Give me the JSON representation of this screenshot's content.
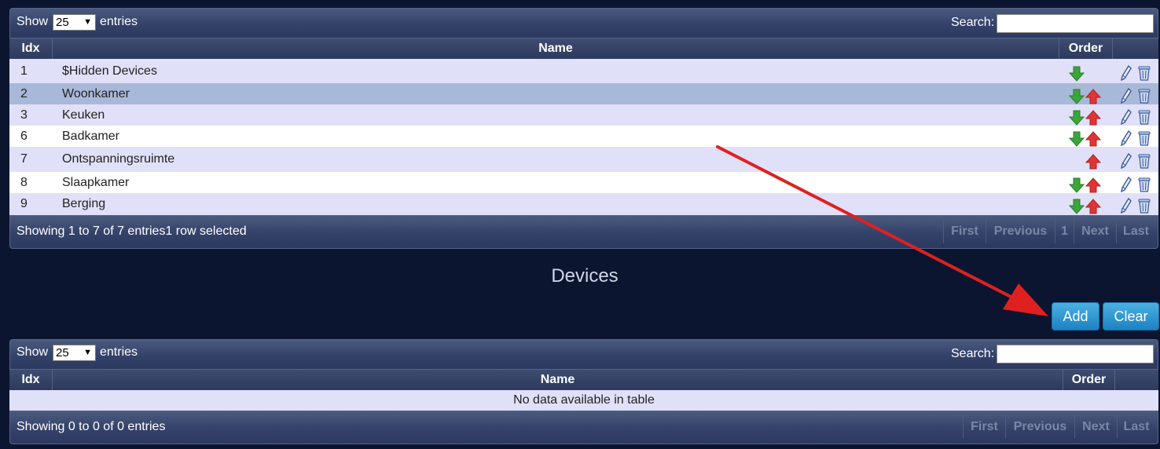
{
  "colors": {
    "background": "#0c1530",
    "row_alt": "#e0e0f8",
    "row_plain": "#ffffff",
    "row_selected": "#a8b8d8",
    "button": "#2a94d0",
    "arrow_annotation": "#e02020",
    "down_arrow": "#3aa63a",
    "up_arrow": "#e03535"
  },
  "plans_table": {
    "show_label": "Show",
    "entries_label": "entries",
    "page_size": "25",
    "search_label": "Search:",
    "search_value": "",
    "columns": [
      "Idx",
      "Name",
      "Order"
    ],
    "rows": [
      {
        "idx": "1",
        "name": "$Hidden Devices",
        "down": true,
        "up": false,
        "selected": false
      },
      {
        "idx": "2",
        "name": "Woonkamer",
        "down": true,
        "up": true,
        "selected": true
      },
      {
        "idx": "3",
        "name": "Keuken",
        "down": true,
        "up": true,
        "selected": false
      },
      {
        "idx": "6",
        "name": "Badkamer",
        "down": true,
        "up": true,
        "selected": false
      },
      {
        "idx": "7",
        "name": "Ontspanningsruimte",
        "down": false,
        "up": true,
        "selected": false
      },
      {
        "idx": "8",
        "name": "Slaapkamer",
        "down": true,
        "up": true,
        "selected": false
      },
      {
        "idx": "9",
        "name": "Berging",
        "down": true,
        "up": true,
        "selected": false
      }
    ],
    "info": "Showing 1 to 7 of 7 entries1 row selected",
    "pagination": {
      "first": "First",
      "previous": "Previous",
      "page": "1",
      "next": "Next",
      "last": "Last"
    },
    "icons": [
      "edit-pencil-icon",
      "trash-bin-icon",
      "arrow-down-icon",
      "arrow-up-icon"
    ]
  },
  "devices_section": {
    "title": "Devices",
    "add_label": "Add",
    "clear_label": "Clear"
  },
  "devices_table": {
    "show_label": "Show",
    "entries_label": "entries",
    "page_size": "25",
    "search_label": "Search:",
    "search_value": "",
    "columns": [
      "Idx",
      "Name",
      "Order"
    ],
    "empty_message": "No data available in table",
    "info": "Showing 0 to 0 of 0 entries",
    "pagination": {
      "first": "First",
      "previous": "Previous",
      "next": "Next",
      "last": "Last"
    }
  }
}
